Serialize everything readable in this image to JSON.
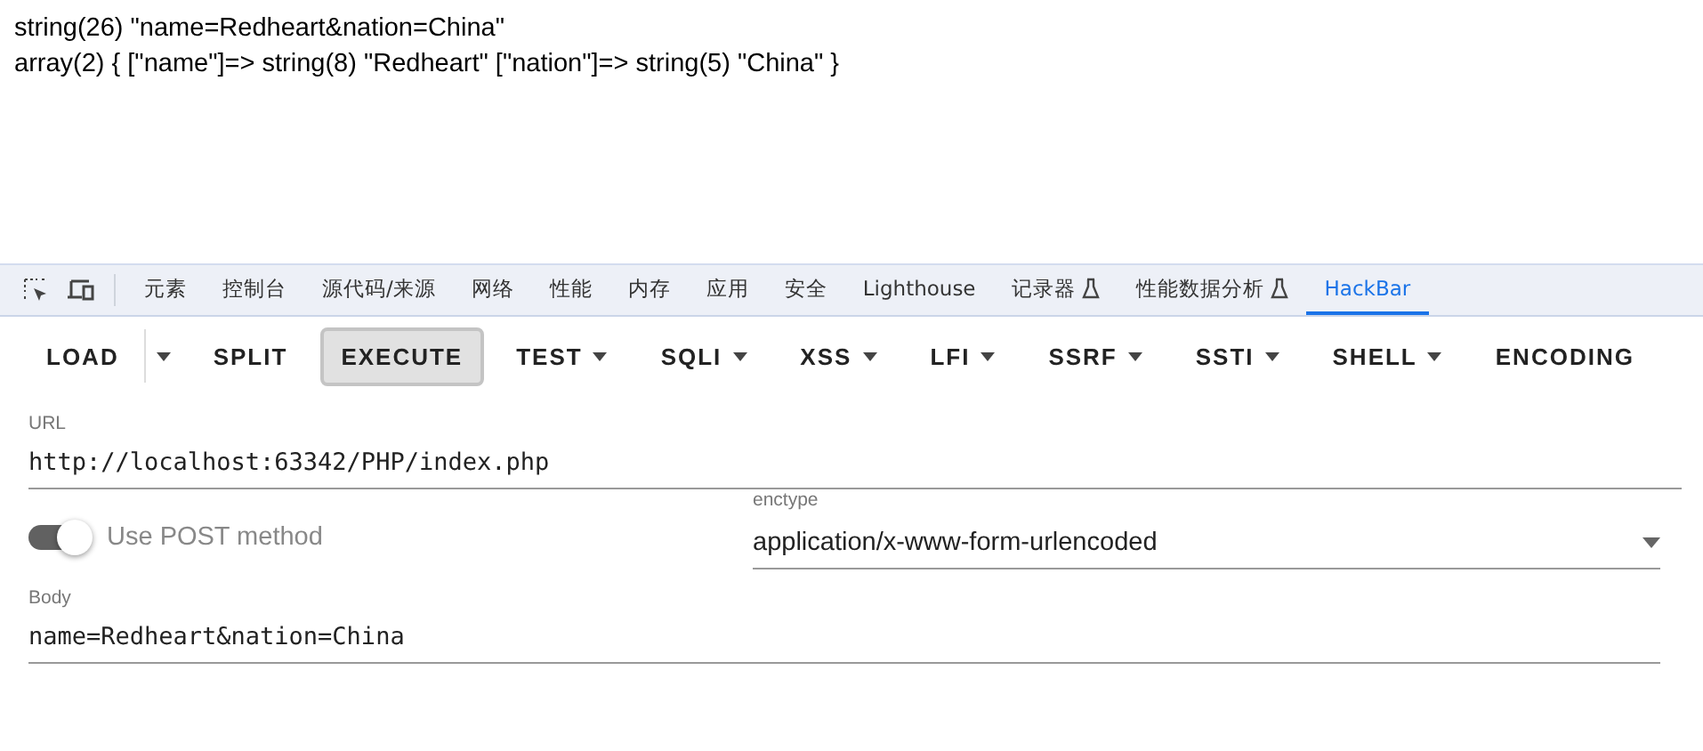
{
  "output_lines": [
    "string(26) \"name=Redheart&nation=China\"",
    "array(2) { [\"name\"]=> string(8) \"Redheart\" [\"nation\"]=> string(5) \"China\" }"
  ],
  "devtools_tabs": [
    {
      "label": "元素",
      "selected": false,
      "experimental": false
    },
    {
      "label": "控制台",
      "selected": false,
      "experimental": false
    },
    {
      "label": "源代码/来源",
      "selected": false,
      "experimental": false
    },
    {
      "label": "网络",
      "selected": false,
      "experimental": false
    },
    {
      "label": "性能",
      "selected": false,
      "experimental": false
    },
    {
      "label": "内存",
      "selected": false,
      "experimental": false
    },
    {
      "label": "应用",
      "selected": false,
      "experimental": false
    },
    {
      "label": "安全",
      "selected": false,
      "experimental": false
    },
    {
      "label": "Lighthouse",
      "selected": false,
      "experimental": false
    },
    {
      "label": "记录器",
      "selected": false,
      "experimental": true
    },
    {
      "label": "性能数据分析",
      "selected": false,
      "experimental": true
    },
    {
      "label": "HackBar",
      "selected": true,
      "experimental": false
    }
  ],
  "toolbar": [
    {
      "label": "LOAD",
      "kind": "split",
      "pressed": false
    },
    {
      "label": "SPLIT",
      "kind": "plain",
      "pressed": false
    },
    {
      "label": "EXECUTE",
      "kind": "plain",
      "pressed": true
    },
    {
      "label": "TEST",
      "kind": "menu",
      "pressed": false
    },
    {
      "label": "SQLI",
      "kind": "menu",
      "pressed": false
    },
    {
      "label": "XSS",
      "kind": "menu",
      "pressed": false
    },
    {
      "label": "LFI",
      "kind": "menu",
      "pressed": false
    },
    {
      "label": "SSRF",
      "kind": "menu",
      "pressed": false
    },
    {
      "label": "SSTI",
      "kind": "menu",
      "pressed": false
    },
    {
      "label": "SHELL",
      "kind": "menu",
      "pressed": false
    },
    {
      "label": "ENCODING",
      "kind": "plain",
      "pressed": false
    }
  ],
  "url": {
    "label": "URL",
    "value": "http://localhost:63342/PHP/index.php"
  },
  "post_switch": {
    "label": "Use POST method",
    "on": true
  },
  "enctype": {
    "label": "enctype",
    "value": "application/x-www-form-urlencoded"
  },
  "body": {
    "label": "Body",
    "value": "name=Redheart&nation=China"
  }
}
